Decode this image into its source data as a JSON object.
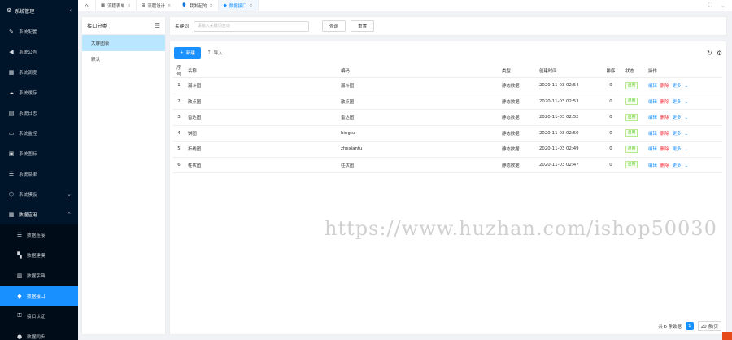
{
  "sidebar": {
    "title": "系统管理",
    "items": [
      {
        "label": "系统配置",
        "icon": "wrench-icon",
        "glyph": "✎"
      },
      {
        "label": "系统公告",
        "icon": "megaphone-icon",
        "glyph": "◀"
      },
      {
        "label": "系统调度",
        "icon": "calendar-icon",
        "glyph": "▦"
      },
      {
        "label": "系统缓存",
        "icon": "cloud-icon",
        "glyph": "☁"
      },
      {
        "label": "系统日志",
        "icon": "log-icon",
        "glyph": "▤"
      },
      {
        "label": "系统监控",
        "icon": "monitor-icon",
        "glyph": "▭"
      },
      {
        "label": "系统图标",
        "icon": "image-icon",
        "glyph": "▣"
      },
      {
        "label": "系统菜单",
        "icon": "menu-icon",
        "glyph": "☰"
      },
      {
        "label": "系统模板",
        "icon": "template-icon",
        "glyph": "⬡"
      },
      {
        "label": "数据应用",
        "icon": "database-icon",
        "glyph": "▦"
      },
      {
        "label": "数据连接",
        "icon": "list-icon",
        "glyph": "☰"
      },
      {
        "label": "数据建模",
        "icon": "model-icon",
        "glyph": "▚"
      },
      {
        "label": "数据字典",
        "icon": "dictionary-icon",
        "glyph": "▥"
      },
      {
        "label": "数据接口",
        "icon": "interface-icon",
        "glyph": "◆"
      },
      {
        "label": "接口认证",
        "icon": "key-icon",
        "glyph": "⚿"
      },
      {
        "label": "数据同步",
        "icon": "sync-icon",
        "glyph": "●"
      }
    ]
  },
  "tabs": [
    {
      "label": "流程表单",
      "glyph": "▦"
    },
    {
      "label": "流程设计",
      "glyph": "⊞"
    },
    {
      "label": "我发起的",
      "glyph": "👤"
    },
    {
      "label": "数据接口",
      "glyph": "◆"
    }
  ],
  "category": {
    "title": "接口分类",
    "items": [
      "大屏图表",
      "默认"
    ]
  },
  "search": {
    "label": "关键词",
    "placeholder": "请输入关键词查询",
    "query_label": "查询",
    "reset_label": "重置"
  },
  "toolbar": {
    "add_label": "新建",
    "import_label": "导入"
  },
  "table": {
    "headers": [
      "序号",
      "名称",
      "编码",
      "类型",
      "创建时间",
      "排序",
      "状态",
      "操作"
    ],
    "rows": [
      {
        "no": "1",
        "name": "漏斗图",
        "code": "漏斗图",
        "type": "静态数据",
        "time": "2020-11-03 02:54",
        "sort": "0",
        "status": "启用"
      },
      {
        "no": "2",
        "name": "散点图",
        "code": "散点图",
        "type": "静态数据",
        "time": "2020-11-03 02:53",
        "sort": "0",
        "status": "启用"
      },
      {
        "no": "3",
        "name": "雷达图",
        "code": "雷达图",
        "type": "静态数据",
        "time": "2020-11-03 02:52",
        "sort": "0",
        "status": "启用"
      },
      {
        "no": "4",
        "name": "饼图",
        "code": "bingtu",
        "type": "静态数据",
        "time": "2020-11-03 02:50",
        "sort": "0",
        "status": "启用"
      },
      {
        "no": "5",
        "name": "折线图",
        "code": "zhexiantu",
        "type": "静态数据",
        "time": "2020-11-03 02:49",
        "sort": "0",
        "status": "启用"
      },
      {
        "no": "6",
        "name": "柱状图",
        "code": "柱状图",
        "type": "静态数据",
        "time": "2020-11-03 02:47",
        "sort": "0",
        "status": "启用"
      }
    ],
    "ops": {
      "edit": "编辑",
      "delete": "删除",
      "more": "更多"
    }
  },
  "watermark": "https://www.huzhan.com/ishop50030",
  "pager": {
    "total": "共 6 条数据",
    "page": "1",
    "size": "20 条/页"
  },
  "colors": {
    "accent": "#1890ff",
    "sidebar": "#001529",
    "success": "#52c41a",
    "danger": "#f5222d"
  }
}
